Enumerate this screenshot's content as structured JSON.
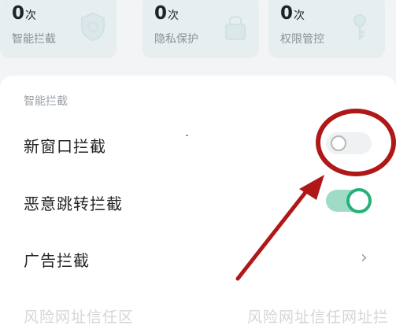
{
  "stats": [
    {
      "count": "0",
      "unit": "次",
      "label": "智能拦截",
      "icon": "shield-icon"
    },
    {
      "count": "0",
      "unit": "次",
      "label": "隐私保护",
      "icon": "lock-icon"
    },
    {
      "count": "0",
      "unit": "次",
      "label": "权限管控",
      "icon": "key-icon"
    }
  ],
  "section_title": "智能拦截",
  "rows": {
    "new_window": {
      "label": "新窗口拦截",
      "toggle_on": false
    },
    "malicious_redirect": {
      "label": "恶意跳转拦截",
      "toggle_on": true
    },
    "ads": {
      "label": "广告拦截",
      "trailing": "›"
    }
  },
  "faded_row": {
    "left": "风险网址信任区",
    "right": "风险网址信任网址拦"
  },
  "colors": {
    "accent_green": "#27b07a",
    "annotation_red": "#b01818",
    "card_bg": "#e6eef0"
  }
}
